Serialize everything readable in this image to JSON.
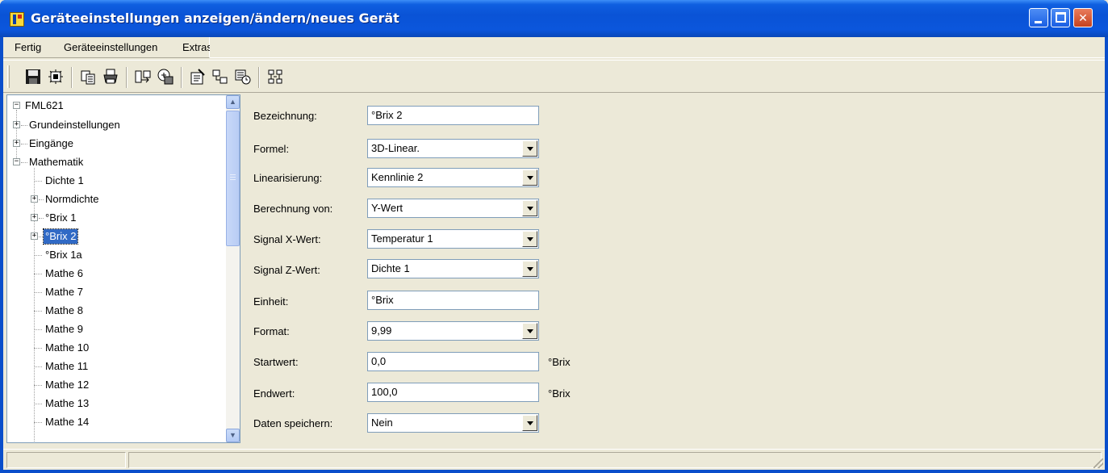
{
  "window": {
    "title": "Geräteeinstellungen anzeigen/ändern/neues Gerät",
    "controls": [
      "minimize",
      "maximize",
      "close"
    ]
  },
  "menu": {
    "items": [
      {
        "label": "Fertig"
      },
      {
        "label": "Geräteeinstellungen"
      },
      {
        "label": "Extras"
      }
    ]
  },
  "toolbar": {
    "buttons": [
      {
        "icon": "save-icon"
      },
      {
        "icon": "device-scan-icon"
      },
      {
        "icon": "copy-icon"
      },
      {
        "icon": "print-icon"
      },
      {
        "icon": "transfer-device-icon"
      },
      {
        "icon": "upload-icon"
      },
      {
        "icon": "properties-icon"
      },
      {
        "icon": "connect-icon"
      },
      {
        "icon": "device-clock-icon"
      },
      {
        "icon": "network-icon"
      }
    ]
  },
  "tree": {
    "root": "FML621",
    "items": [
      {
        "label": "Grundeinstellungen",
        "level": 1,
        "expander": "+"
      },
      {
        "label": "Eingänge",
        "level": 1,
        "expander": "+"
      },
      {
        "label": "Mathematik",
        "level": 1,
        "expander": "-"
      },
      {
        "label": "Dichte 1",
        "level": 2,
        "expander": ""
      },
      {
        "label": "Normdichte",
        "level": 2,
        "expander": "+"
      },
      {
        "label": "°Brix 1",
        "level": 2,
        "expander": "+"
      },
      {
        "label": "°Brix 2",
        "level": 2,
        "expander": "+",
        "selected": true
      },
      {
        "label": "°Brix 1a",
        "level": 2,
        "expander": ""
      },
      {
        "label": "Mathe 6",
        "level": 2,
        "expander": ""
      },
      {
        "label": "Mathe 7",
        "level": 2,
        "expander": ""
      },
      {
        "label": "Mathe 8",
        "level": 2,
        "expander": ""
      },
      {
        "label": "Mathe 9",
        "level": 2,
        "expander": ""
      },
      {
        "label": "Mathe 10",
        "level": 2,
        "expander": ""
      },
      {
        "label": "Mathe 11",
        "level": 2,
        "expander": ""
      },
      {
        "label": "Mathe 12",
        "level": 2,
        "expander": ""
      },
      {
        "label": "Mathe 13",
        "level": 2,
        "expander": ""
      },
      {
        "label": "Mathe 14",
        "level": 2,
        "expander": ""
      }
    ]
  },
  "form": {
    "bezeichnung": {
      "label": "Bezeichnung:",
      "value": "°Brix 2"
    },
    "formel": {
      "label": "Formel:",
      "value": "3D-Linear."
    },
    "linearisierung": {
      "label": "Linearisierung:",
      "value": "Kennlinie 2"
    },
    "berechnung": {
      "label": "Berechnung von:",
      "value": "Y-Wert"
    },
    "signal_x": {
      "label": "Signal X-Wert:",
      "value": "Temperatur 1"
    },
    "signal_z": {
      "label": "Signal Z-Wert:",
      "value": "Dichte 1"
    },
    "einheit": {
      "label": "Einheit:",
      "value": "°Brix"
    },
    "format": {
      "label": "Format:",
      "value": "9,99"
    },
    "startwert": {
      "label": "Startwert:",
      "value": "0,0",
      "unit": "°Brix"
    },
    "endwert": {
      "label": "Endwert:",
      "value": "100,0",
      "unit": "°Brix"
    },
    "daten_speichern": {
      "label": "Daten speichern:",
      "value": "Nein"
    }
  },
  "colors": {
    "titlebar": "#0a53d6",
    "selection": "#316ac5",
    "face": "#ece9d8"
  }
}
